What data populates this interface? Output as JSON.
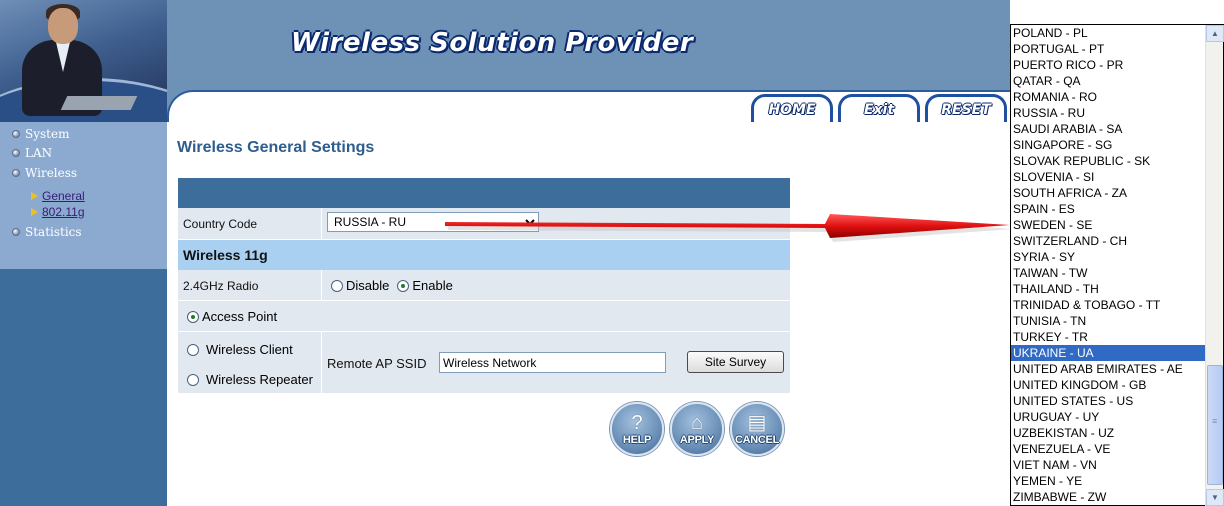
{
  "header": {
    "brand": "Wireless Solution Provider",
    "buttons": {
      "home": "HOME",
      "exit": "Exit",
      "reset": "RESET"
    }
  },
  "sidebar": {
    "items": [
      "System",
      "LAN",
      "Wireless",
      "Statistics"
    ],
    "subitems": [
      "General",
      "802.11g"
    ]
  },
  "page": {
    "title": "Wireless General Settings"
  },
  "form": {
    "country_label": "Country Code",
    "country_value": "RUSSIA - RU",
    "section_title": "Wireless 11g",
    "radio_label": "2.4GHz Radio",
    "disable_label": "Disable",
    "enable_label": "Enable",
    "radio_state": "Enable",
    "mode_ap": "Access Point",
    "mode_client": "Wireless Client",
    "mode_repeater": "Wireless Repeater",
    "mode_selected": "Access Point",
    "ssid_label": "Remote AP SSID",
    "ssid_value": "Wireless Network",
    "site_survey": "Site Survey"
  },
  "actions": {
    "help": "HELP",
    "apply": "APPLY",
    "cancel": "CANCEL"
  },
  "dropdown": {
    "selected": "UKRAINE - UA",
    "options": [
      "POLAND - PL",
      "PORTUGAL - PT",
      "PUERTO RICO - PR",
      "QATAR - QA",
      "ROMANIA - RO",
      "RUSSIA - RU",
      "SAUDI ARABIA - SA",
      "SINGAPORE - SG",
      "SLOVAK REPUBLIC - SK",
      "SLOVENIA - SI",
      "SOUTH AFRICA - ZA",
      "SPAIN - ES",
      "SWEDEN - SE",
      "SWITZERLAND - CH",
      "SYRIA - SY",
      "TAIWAN - TW",
      "THAILAND - TH",
      "TRINIDAD & TOBAGO - TT",
      "TUNISIA - TN",
      "TURKEY - TR",
      "UKRAINE - UA",
      "UNITED ARAB EMIRATES - AE",
      "UNITED KINGDOM - GB",
      "UNITED STATES - US",
      "URUGUAY - UY",
      "UZBEKISTAN - UZ",
      "VENEZUELA - VE",
      "VIET NAM - VN",
      "YEMEN - YE",
      "ZIMBABWE - ZW"
    ]
  },
  "colors": {
    "sidebar": "#3d6d9a",
    "header": "#6e92b6",
    "title": "#2e5d8e",
    "section": "#a9d0f0",
    "arrow": "#e01010",
    "selection": "#316ac5"
  }
}
